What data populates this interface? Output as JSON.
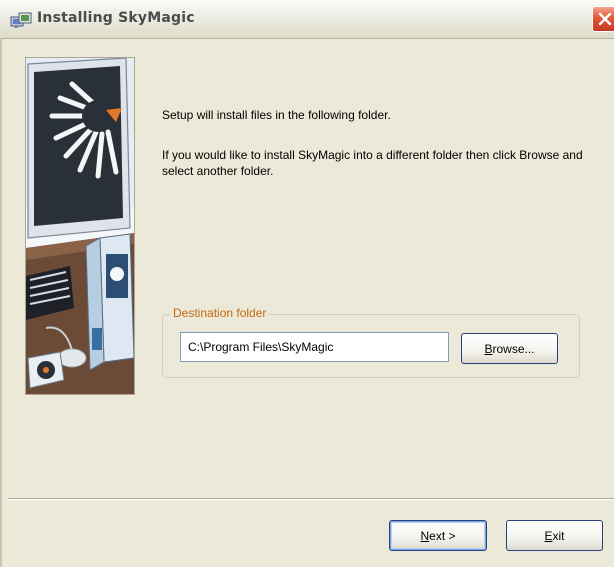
{
  "window": {
    "title": "Installing SkyMagic",
    "icon": "installer-icon",
    "close_icon": "close-icon"
  },
  "content": {
    "intro": "Setup will install files in the following folder.",
    "description": "If you would like to install SkyMagic into a different folder then click Browse and select another folder."
  },
  "destination": {
    "group_label": "Destination folder",
    "path": "C:\\Program Files\\SkyMagic",
    "browse": {
      "mnemonic": "B",
      "rest": "rowse..."
    }
  },
  "footer": {
    "next": {
      "mnemonic": "N",
      "rest": "ext >"
    },
    "exit": {
      "mnemonic": "E",
      "rest": "xit"
    }
  },
  "colors": {
    "dialog_background": "#ECE9D8",
    "group_label": "#C56A12",
    "close_button": "#E2563A",
    "button_border": "#2A3F7D"
  }
}
